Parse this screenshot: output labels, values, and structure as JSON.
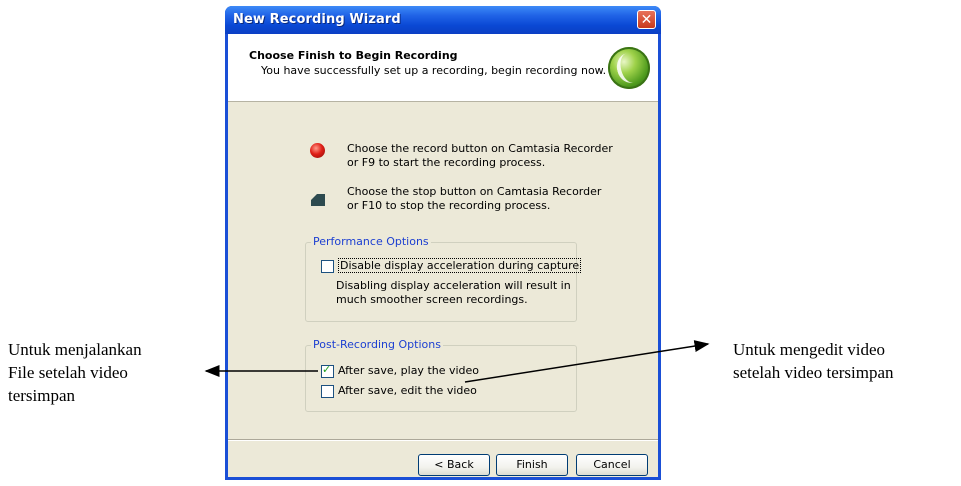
{
  "window": {
    "title": "New Recording Wizard",
    "close_glyph": "✕"
  },
  "header": {
    "title": "Choose Finish to Begin Recording",
    "subtitle": "You have successfully set up a recording, begin recording now.",
    "logo_icon": "camtasia-logo-icon"
  },
  "steps": [
    {
      "icon": "record-icon",
      "text": "Choose the record button on Camtasia Recorder\nor F9 to start the recording process."
    },
    {
      "icon": "stop-icon",
      "text": "Choose the stop button on Camtasia Recorder\nor F10 to stop the recording process."
    }
  ],
  "performance": {
    "label": "Performance Options",
    "checkbox_label": "Disable display acceleration during capture",
    "checked": false,
    "note": "Disabling display acceleration will result in\nmuch smoother screen recordings."
  },
  "post": {
    "label": "Post-Recording Options",
    "options": [
      {
        "label": "After save, play the video",
        "checked": true
      },
      {
        "label": "After save, edit the video",
        "checked": false
      }
    ]
  },
  "buttons": {
    "back": "< Back",
    "finish": "Finish",
    "cancel": "Cancel"
  },
  "annotations": {
    "left": "Untuk menjalankan\nFile setelah video\ntersimpan",
    "right": "Untuk mengedit video\nsetelah video tersimpan"
  },
  "colors": {
    "titlebar": "#0a48d4",
    "client_bg": "#ece9d8",
    "groupbox_label": "#1c3fd1"
  }
}
